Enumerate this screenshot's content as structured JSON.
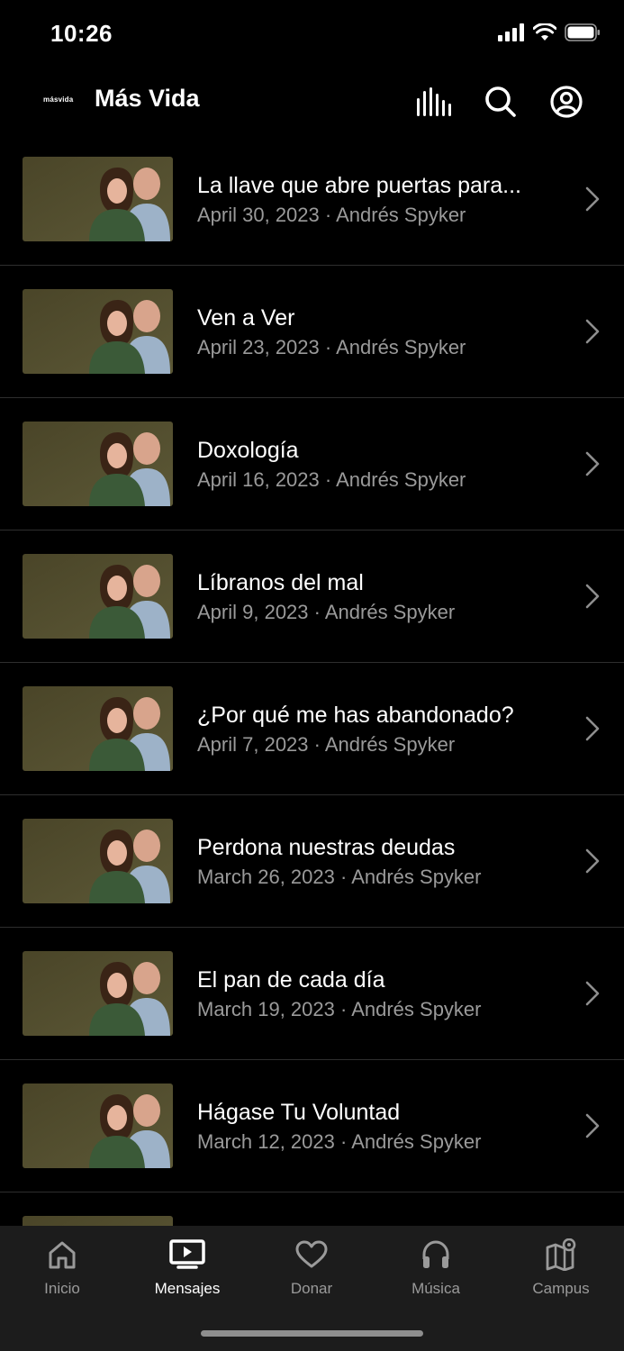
{
  "status": {
    "time": "10:26"
  },
  "header": {
    "logo_text": "másvida",
    "title": "Más Vida"
  },
  "messages": [
    {
      "title": "La llave que abre puertas para...",
      "subtitle": "April 30, 2023 · Andrés Spyker"
    },
    {
      "title": "Ven a Ver",
      "subtitle": "April 23, 2023 · Andrés Spyker"
    },
    {
      "title": "Doxología",
      "subtitle": "April 16, 2023 · Andrés Spyker"
    },
    {
      "title": "Líbranos del mal",
      "subtitle": "April 9, 2023 · Andrés Spyker"
    },
    {
      "title": "¿Por qué me has abandonado?",
      "subtitle": "April 7, 2023 · Andrés Spyker"
    },
    {
      "title": "Perdona nuestras deudas",
      "subtitle": "March 26, 2023 · Andrés Spyker"
    },
    {
      "title": "El pan de cada día",
      "subtitle": "March 19, 2023 · Andrés Spyker"
    },
    {
      "title": "Hágase Tu Voluntad",
      "subtitle": "March 12, 2023 · Andrés Spyker"
    },
    {
      "title": "",
      "subtitle": ""
    }
  ],
  "tabs": [
    {
      "label": "Inicio",
      "icon": "home-icon"
    },
    {
      "label": "Mensajes",
      "icon": "tv-icon",
      "active": true
    },
    {
      "label": "Donar",
      "icon": "heart-icon"
    },
    {
      "label": "Música",
      "icon": "headphones-icon"
    },
    {
      "label": "Campus",
      "icon": "map-pin-icon"
    }
  ],
  "colors": {
    "background": "#000000",
    "tab_bar": "#1c1c1c",
    "secondary_text": "#9a9a9a",
    "divider": "#2e2e2e"
  }
}
